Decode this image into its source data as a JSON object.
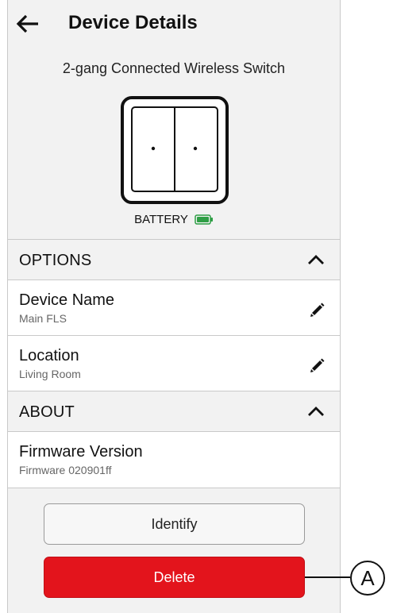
{
  "header": {
    "title": "Device Details",
    "back_icon": "back-arrow-icon"
  },
  "device": {
    "model": "2-gang Connected Wireless Switch",
    "battery_label": "BATTERY",
    "battery_color": "#2e9e45"
  },
  "options": {
    "label": "OPTIONS",
    "rows": [
      {
        "title": "Device Name",
        "value": "Main FLS",
        "icon": "pencil-icon"
      },
      {
        "title": "Location",
        "value": "Living Room",
        "icon": "pencil-icon"
      }
    ]
  },
  "about": {
    "label": "ABOUT",
    "rows": [
      {
        "title": "Firmware Version",
        "value": "Firmware 020901ff"
      }
    ]
  },
  "actions": {
    "identify_label": "Identify",
    "delete_label": "Delete",
    "delete_color": "#e3141c"
  },
  "callout": {
    "label": "A"
  }
}
